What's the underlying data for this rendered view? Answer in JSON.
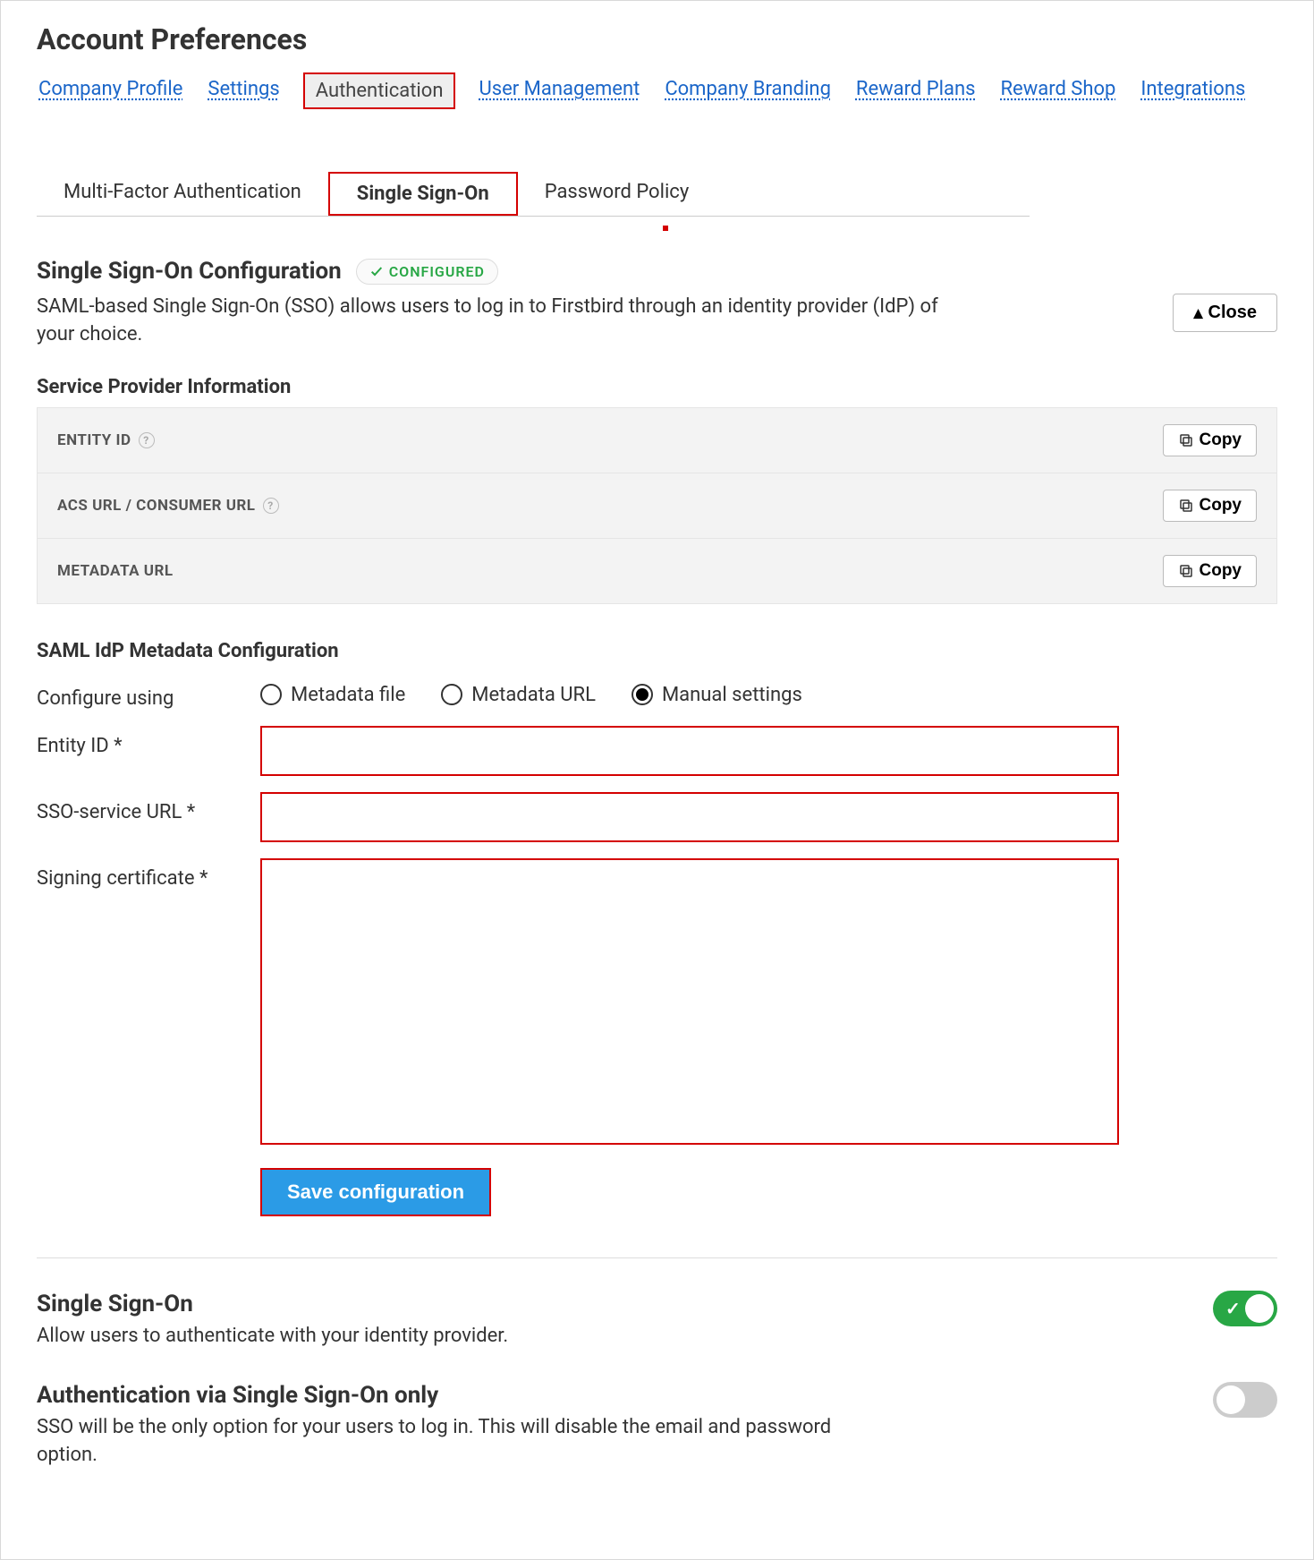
{
  "page_title": "Account Preferences",
  "top_tabs": {
    "company_profile": "Company Profile",
    "settings": "Settings",
    "authentication": "Authentication",
    "user_management": "User Management",
    "company_branding": "Company Branding",
    "reward_plans": "Reward Plans",
    "reward_shop": "Reward Shop",
    "integrations": "Integrations"
  },
  "sub_tabs": {
    "mfa": "Multi-Factor Authentication",
    "sso": "Single Sign-On",
    "password": "Password Policy"
  },
  "sso_config": {
    "heading": "Single Sign-On Configuration",
    "badge": "CONFIGURED",
    "description": "SAML-based Single Sign-On (SSO) allows users to log in to Firstbird through an identity provider (IdP) of your choice.",
    "close_label": "Close"
  },
  "sp_info": {
    "heading": "Service Provider Information",
    "rows": {
      "entity_id": "ENTITY ID",
      "acs_url": "ACS URL / CONSUMER URL",
      "metadata_url": "METADATA URL"
    },
    "copy_label": "Copy"
  },
  "idp_config": {
    "heading": "SAML IdP Metadata Configuration",
    "configure_using_label": "Configure using",
    "options": {
      "metadata_file": "Metadata file",
      "metadata_url": "Metadata URL",
      "manual": "Manual settings"
    },
    "entity_id_label": "Entity ID *",
    "sso_url_label": "SSO-service URL *",
    "signing_cert_label": "Signing certificate *",
    "save_label": "Save configuration"
  },
  "toggles": {
    "sso": {
      "title": "Single Sign-On",
      "desc": "Allow users to authenticate with your identity provider.",
      "on": true
    },
    "sso_only": {
      "title": "Authentication via Single Sign-On only",
      "desc": "SSO will be the only option for your users to log in. This will disable the email and password option.",
      "on": false
    }
  }
}
